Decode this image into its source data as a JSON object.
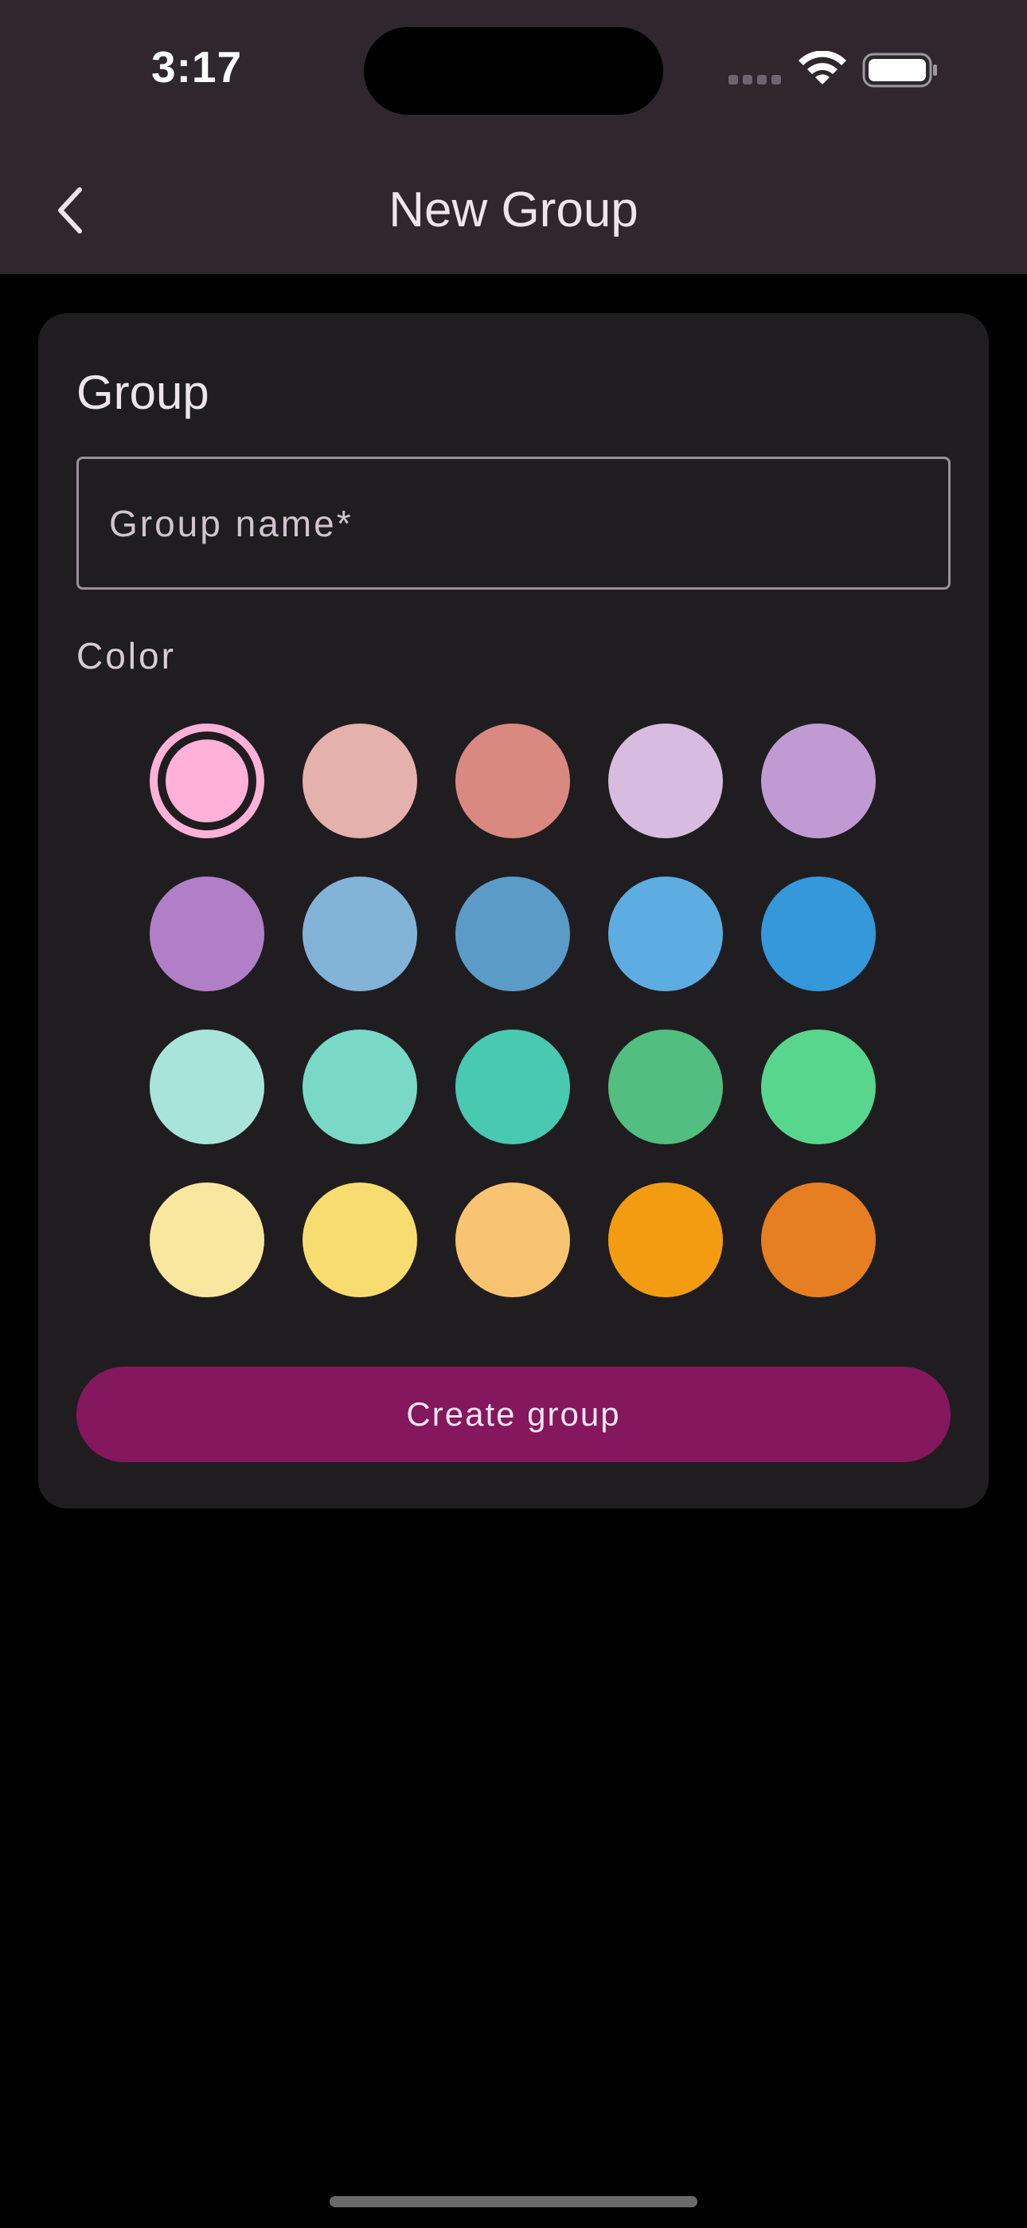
{
  "status_bar": {
    "time": "3:17",
    "icons": [
      "signal-icon",
      "wifi-icon",
      "battery-icon"
    ]
  },
  "nav": {
    "back_icon": "chevron-left-icon",
    "title": "New Group"
  },
  "form": {
    "section_title": "Group",
    "name_field": {
      "value": "",
      "placeholder": "Group name*"
    },
    "color_label": "Color",
    "selected_color": "#FFB1D8",
    "swatches": [
      "#FFB1D8",
      "#E5B1AC",
      "#D98980",
      "#D7BCE0",
      "#C09BD3",
      "#B07FC8",
      "#84B3D8",
      "#5A9BC8",
      "#5DADE2",
      "#3498DB",
      "#A9E4DA",
      "#7AD8C6",
      "#48C9B0",
      "#52BE80",
      "#58D68D",
      "#F9E79F",
      "#F7DC6F",
      "#F8C471",
      "#F39C12",
      "#E67E22"
    ],
    "submit_label": "Create group"
  },
  "colors": {
    "header_bg": "#30262E",
    "card_bg": "#201D21",
    "accent": "#84175D"
  }
}
